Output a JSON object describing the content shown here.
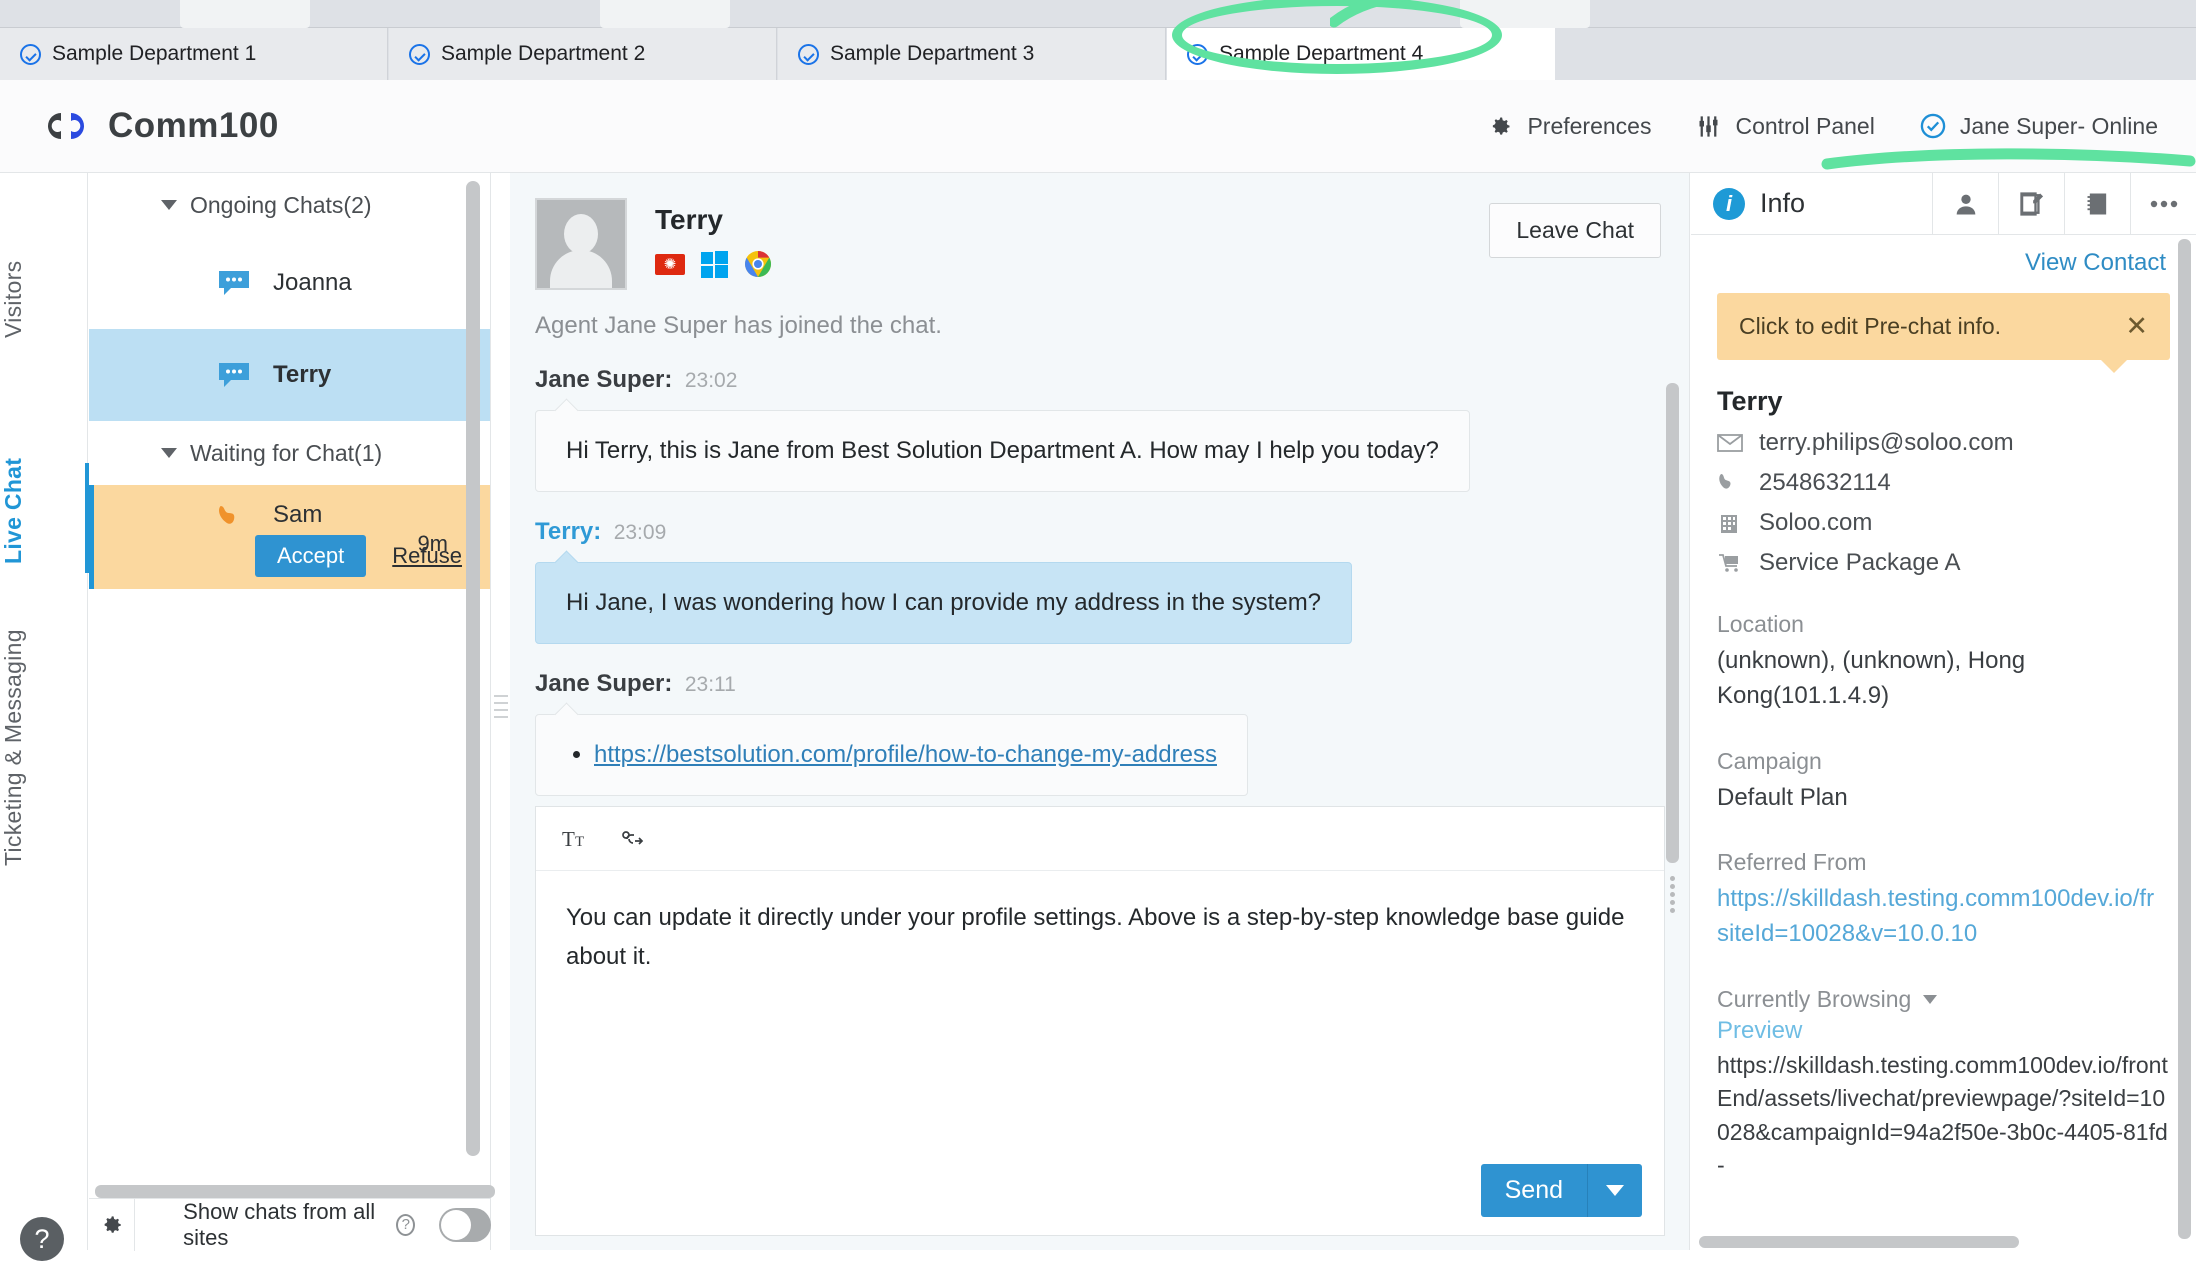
{
  "browser": {
    "tabs": [
      {
        "label": "Sample Department 1",
        "icon": "check-circle-icon",
        "active": false
      },
      {
        "label": "Sample Department 2",
        "icon": "check-circle-icon",
        "active": false
      },
      {
        "label": "Sample Department 3",
        "icon": "check-circle-icon",
        "active": false
      },
      {
        "label": "Sample Department 4",
        "icon": "check-circle-icon",
        "active": true
      }
    ]
  },
  "annotation": {
    "color": "#5fe2a0",
    "circle_target": "Sample Department 4",
    "underline_target": "Jane Super- Online"
  },
  "header": {
    "logo_text": "Comm100",
    "logo_colors": {
      "dark": "#3c4043",
      "blue": "#2b4ae0"
    },
    "nav": [
      {
        "label": "Preferences",
        "icon": "gear-icon"
      },
      {
        "label": "Control Panel",
        "icon": "sliders-icon"
      },
      {
        "label": "Jane Super- Online",
        "icon": "check-circle-icon"
      }
    ]
  },
  "rail": {
    "items": [
      {
        "label": "Visitors",
        "active": false
      },
      {
        "label": "Live Chat",
        "active": true
      },
      {
        "label": "Ticketing & Messaging",
        "active": false
      }
    ],
    "help_icon": "question-mark-icon",
    "active_color": "#2196d6"
  },
  "chat_list": {
    "groups": [
      {
        "title": "Ongoing Chats(2)",
        "rows": [
          {
            "name": "Joanna",
            "icon": "chat-bubble-icon",
            "state": "normal"
          },
          {
            "name": "Terry",
            "icon": "chat-bubble-icon",
            "state": "selected"
          }
        ]
      },
      {
        "title": "Waiting for Chat(1)",
        "rows": [
          {
            "name": "Sam",
            "icon": "phone-icon",
            "state": "waiting",
            "accept_label": "Accept",
            "refuse_label": "Refuse",
            "wait_time": "9m"
          }
        ]
      }
    ],
    "footer": {
      "gear_icon": "gear-icon",
      "toggle_label": "Show chats from all sites",
      "help_icon": "question-circle-icon",
      "toggle_on": false
    }
  },
  "conversation": {
    "visitor_name": "Terry",
    "badges": [
      "hong-kong-flag-icon",
      "windows-icon",
      "chrome-icon"
    ],
    "leave_chat_label": "Leave Chat",
    "system_note": "Agent Jane Super has joined the chat.",
    "messages": [
      {
        "author": "Jane Super:",
        "time": "23:02",
        "side": "agent",
        "text": "Hi Terry, this is Jane from Best Solution Department A. How may I help you today?"
      },
      {
        "author": "Terry:",
        "time": "23:09",
        "side": "visitor",
        "text": "Hi Jane, I was wondering how I can provide my address in the system?"
      },
      {
        "author": "Jane Super:",
        "time": "23:11",
        "side": "agent",
        "link": "https://bestsolution.com/profile/how-to-change-my-address"
      }
    ],
    "composer": {
      "tools": [
        {
          "icon": "text-format-icon",
          "label": "Tt"
        },
        {
          "icon": "link-share-icon",
          "label": ""
        }
      ],
      "draft": "You can update it directly under your profile settings. Above is a step-by-step knowledge base guide about it.",
      "send_label": "Send",
      "send_caret_icon": "chevron-down-icon"
    }
  },
  "info_panel": {
    "title": "Info",
    "title_icon": "info-icon",
    "actions": [
      {
        "icon": "person-icon"
      },
      {
        "icon": "edit-square-icon"
      },
      {
        "icon": "notebook-icon"
      },
      {
        "icon": "more-dots-icon"
      }
    ],
    "view_contact_label": "View Contact",
    "prechat_banner": {
      "text": "Click to edit Pre-chat info.",
      "close_icon": "close-icon",
      "color": "#fbd89f"
    },
    "contact_name": "Terry",
    "contact_lines": [
      {
        "icon": "envelope-icon",
        "value": "terry.philips@soloo.com"
      },
      {
        "icon": "phone-icon",
        "value": "2548632114"
      },
      {
        "icon": "building-icon",
        "value": "Soloo.com"
      },
      {
        "icon": "cart-icon",
        "value": "Service Package A"
      }
    ],
    "sections": [
      {
        "label": "Location",
        "value": "(unknown), (unknown), Hong Kong(101.1.4.9)",
        "is_link": false
      },
      {
        "label": "Campaign",
        "value": "Default Plan",
        "is_link": false
      },
      {
        "label": "Referred From",
        "value": "https://skilldash.testing.comm100dev.io/fr siteId=10028&v=10.0.10",
        "is_link": true
      }
    ],
    "browsing": {
      "label": "Currently Browsing",
      "caret_icon": "chevron-down-icon",
      "preview_label": "Preview",
      "url": "https://skilldash.testing.comm100dev.io/frontEnd/assets/livechat/previewpage/?siteId=10028&campaignId=94a2f50e-3b0c-4405-81fd-"
    }
  }
}
